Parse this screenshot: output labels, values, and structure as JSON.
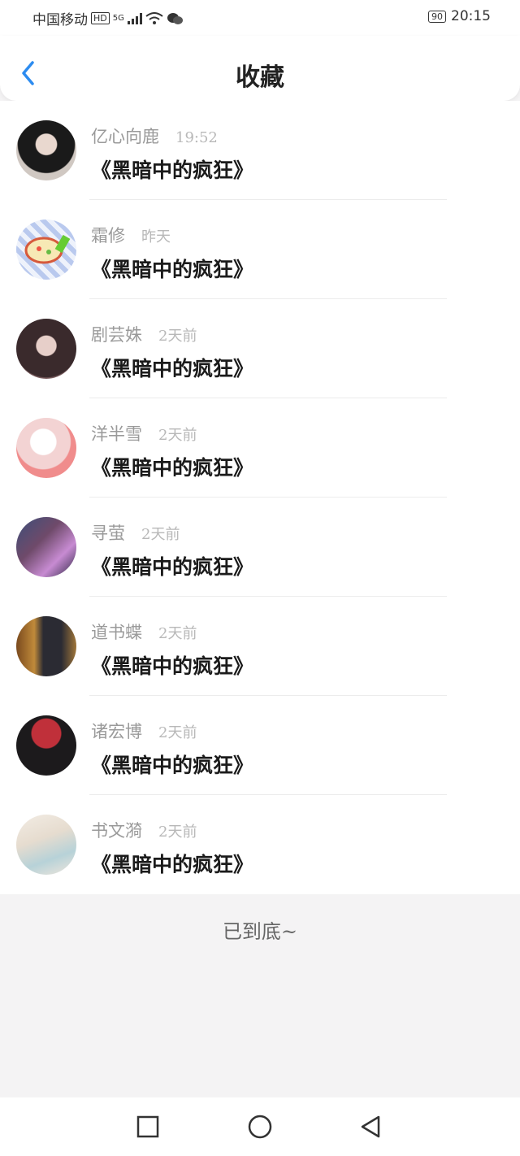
{
  "status_bar": {
    "carrier": "中国移动",
    "hd": "HD",
    "signal": "5G",
    "battery": "90",
    "time": "20:15"
  },
  "header": {
    "back_icon": "chevron-left-icon",
    "title": "收藏"
  },
  "items": [
    {
      "name": "亿心向鹿",
      "time": "19:52",
      "title": "《黑暗中的疯狂》"
    },
    {
      "name": "霜修",
      "time": "昨天",
      "title": "《黑暗中的疯狂》"
    },
    {
      "name": "剧芸姝",
      "time": "2天前",
      "title": "《黑暗中的疯狂》"
    },
    {
      "name": "洋半雪",
      "time": "2天前",
      "title": "《黑暗中的疯狂》"
    },
    {
      "name": "寻萤",
      "time": "2天前",
      "title": "《黑暗中的疯狂》"
    },
    {
      "name": "道书蝶",
      "time": "2天前",
      "title": "《黑暗中的疯狂》"
    },
    {
      "name": "诸宏博",
      "time": "2天前",
      "title": "《黑暗中的疯狂》"
    },
    {
      "name": "书文漪",
      "time": "2天前",
      "title": "《黑暗中的疯狂》"
    }
  ],
  "end_text": "已到底~",
  "nav": {
    "recents_icon": "square-icon",
    "home_icon": "circle-icon",
    "back_icon": "triangle-back-icon"
  },
  "colors": {
    "accent": "#2d8cf0",
    "page_bg": "#f4f3f4"
  }
}
